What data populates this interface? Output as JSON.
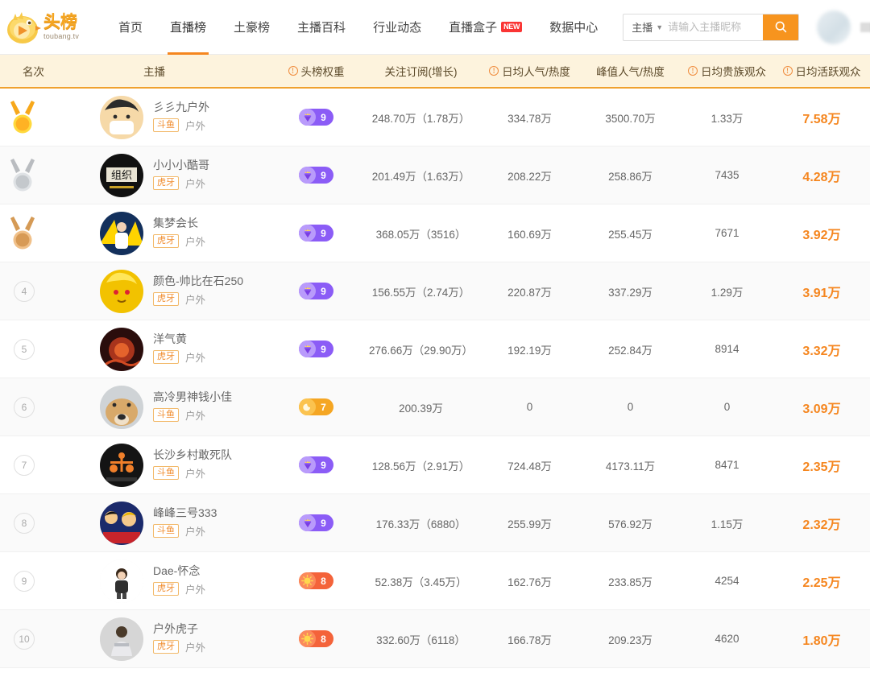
{
  "site": {
    "logo_cn": "头榜",
    "logo_en": "toubang.tv"
  },
  "nav": {
    "items": [
      {
        "label": "首页",
        "active": false,
        "badge": ""
      },
      {
        "label": "直播榜",
        "active": true,
        "badge": ""
      },
      {
        "label": "土豪榜",
        "active": false,
        "badge": ""
      },
      {
        "label": "主播百科",
        "active": false,
        "badge": ""
      },
      {
        "label": "行业动态",
        "active": false,
        "badge": ""
      },
      {
        "label": "直播盒子",
        "active": false,
        "badge": "NEW"
      },
      {
        "label": "数据中心",
        "active": false,
        "badge": ""
      }
    ]
  },
  "search": {
    "type_label": "主播",
    "placeholder": "请输入主播昵称",
    "value": "",
    "icon": "search-icon",
    "accent_color": "#f7941e"
  },
  "user": {
    "avatar": "blurred-avatar",
    "name": "",
    "masked": true
  },
  "table": {
    "columns": [
      {
        "key": "rank",
        "label": "名次",
        "info": false
      },
      {
        "key": "anchor",
        "label": "主播",
        "info": false
      },
      {
        "key": "weight",
        "label": "头榜权重",
        "info": true
      },
      {
        "key": "follow",
        "label": "关注订阅(增长)",
        "info": false
      },
      {
        "key": "avg",
        "label": "日均人气/热度",
        "info": true
      },
      {
        "key": "peak",
        "label": "峰值人气/热度",
        "info": false
      },
      {
        "key": "noble",
        "label": "日均贵族观众",
        "info": true
      },
      {
        "key": "active",
        "label": "日均活跃观众",
        "info": true
      }
    ],
    "rows": [
      {
        "rank": "1",
        "medal": "gold-medal-icon",
        "name": "彡彡九户外",
        "platform": "斗鱼",
        "category": "户外",
        "avatar": "avatar-cartoon-mask",
        "weight": "9",
        "weight_style": "purple",
        "weight_icon": "diamond-icon",
        "follow": "248.70万（1.78万）",
        "avg": "334.78万",
        "peak": "3500.70万",
        "noble": "1.33万",
        "active": "7.58万"
      },
      {
        "rank": "2",
        "medal": "silver-medal-icon",
        "name": "小小小酷哥",
        "platform": "虎牙",
        "category": "户外",
        "avatar": "avatar-black-logo",
        "weight": "9",
        "weight_style": "purple",
        "weight_icon": "diamond-icon",
        "follow": "201.49万（1.63万）",
        "avg": "208.22万",
        "peak": "258.86万",
        "noble": "7435",
        "active": "4.28万"
      },
      {
        "rank": "3",
        "medal": "bronze-medal-icon",
        "name": "集梦会长",
        "platform": "虎牙",
        "category": "户外",
        "avatar": "avatar-blue-stage",
        "weight": "9",
        "weight_style": "purple",
        "weight_icon": "diamond-icon",
        "follow": "368.05万（3516）",
        "avg": "160.69万",
        "peak": "255.45万",
        "noble": "7671",
        "active": "3.92万"
      },
      {
        "rank": "4",
        "medal": "",
        "name": "颜色-帅比在石250",
        "platform": "虎牙",
        "category": "户外",
        "avatar": "avatar-yellow-anime",
        "weight": "9",
        "weight_style": "purple",
        "weight_icon": "diamond-icon",
        "follow": "156.55万（2.74万）",
        "avg": "220.87万",
        "peak": "337.29万",
        "noble": "1.29万",
        "active": "3.91万"
      },
      {
        "rank": "5",
        "medal": "",
        "name": "洋气黄",
        "platform": "虎牙",
        "category": "户外",
        "avatar": "avatar-dark-red",
        "weight": "9",
        "weight_style": "purple",
        "weight_icon": "diamond-icon",
        "follow": "276.66万（29.90万）",
        "avg": "192.19万",
        "peak": "252.84万",
        "noble": "8914",
        "active": "3.32万"
      },
      {
        "rank": "6",
        "medal": "",
        "name": "高冷男神钱小佳",
        "platform": "斗鱼",
        "category": "户外",
        "avatar": "avatar-dog",
        "weight": "7",
        "weight_style": "orange",
        "weight_icon": "moon-icon",
        "follow": "200.39万",
        "avg": "0",
        "peak": "0",
        "noble": "0",
        "active": "3.09万"
      },
      {
        "rank": "7",
        "medal": "",
        "name": "长沙乡村敢死队",
        "platform": "斗鱼",
        "category": "户外",
        "avatar": "avatar-black-team",
        "weight": "9",
        "weight_style": "purple",
        "weight_icon": "diamond-icon",
        "follow": "128.56万（2.91万）",
        "avg": "724.48万",
        "peak": "4173.11万",
        "noble": "8471",
        "active": "2.35万"
      },
      {
        "rank": "8",
        "medal": "",
        "name": "峰峰三号333",
        "platform": "斗鱼",
        "category": "户外",
        "avatar": "avatar-anime-group",
        "weight": "9",
        "weight_style": "purple",
        "weight_icon": "diamond-icon",
        "follow": "176.33万（6880）",
        "avg": "255.99万",
        "peak": "576.92万",
        "noble": "1.15万",
        "active": "2.32万"
      },
      {
        "rank": "9",
        "medal": "",
        "name": "Dae-怀念",
        "platform": "虎牙",
        "category": "户外",
        "avatar": "avatar-white-cartoon",
        "weight": "8",
        "weight_style": "red",
        "weight_icon": "sun-icon",
        "follow": "52.38万（3.45万）",
        "avg": "162.76万",
        "peak": "233.85万",
        "noble": "4254",
        "active": "2.25万"
      },
      {
        "rank": "10",
        "medal": "",
        "name": "户外虎子",
        "platform": "虎牙",
        "category": "户外",
        "avatar": "avatar-gray-person",
        "weight": "8",
        "weight_style": "red",
        "weight_icon": "sun-icon",
        "follow": "332.60万（6118）",
        "avg": "166.78万",
        "peak": "209.23万",
        "noble": "4620",
        "active": "1.80万"
      }
    ]
  }
}
